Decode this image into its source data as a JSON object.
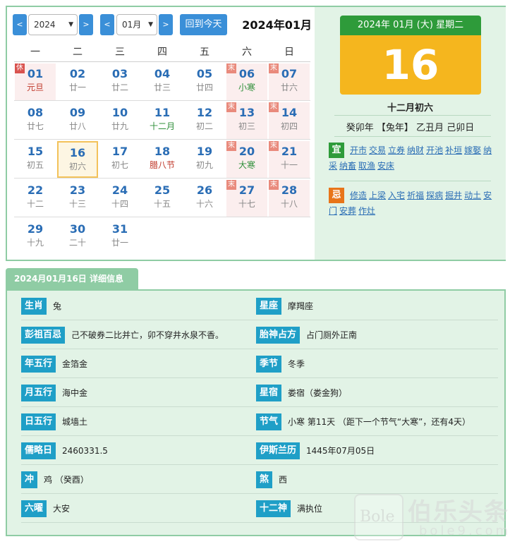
{
  "toolbar": {
    "prev_label": "<",
    "next_label": ">",
    "year_value": "2024",
    "month_value": "01月",
    "today_label": "回到今天",
    "current_title": "2024年01月"
  },
  "weekdays": [
    "一",
    "二",
    "三",
    "四",
    "五",
    "六",
    "日"
  ],
  "weeks": [
    [
      {
        "day": "01",
        "lunar": "元旦",
        "tag": "休",
        "lunar_style": "red"
      },
      {
        "day": "02",
        "lunar": "廿一"
      },
      {
        "day": "03",
        "lunar": "廿二"
      },
      {
        "day": "04",
        "lunar": "廿三"
      },
      {
        "day": "05",
        "lunar": "廿四"
      },
      {
        "day": "06",
        "lunar": "小寒",
        "tag": "末",
        "lunar_style": "green"
      },
      {
        "day": "07",
        "lunar": "廿六",
        "tag": "末"
      }
    ],
    [
      {
        "day": "08",
        "lunar": "廿七"
      },
      {
        "day": "09",
        "lunar": "廿八"
      },
      {
        "day": "10",
        "lunar": "廿九"
      },
      {
        "day": "11",
        "lunar": "十二月",
        "lunar_style": "green"
      },
      {
        "day": "12",
        "lunar": "初二"
      },
      {
        "day": "13",
        "lunar": "初三",
        "tag": "末"
      },
      {
        "day": "14",
        "lunar": "初四",
        "tag": "末"
      }
    ],
    [
      {
        "day": "15",
        "lunar": "初五"
      },
      {
        "day": "16",
        "lunar": "初六",
        "today": true
      },
      {
        "day": "17",
        "lunar": "初七"
      },
      {
        "day": "18",
        "lunar": "腊八节",
        "lunar_style": "red"
      },
      {
        "day": "19",
        "lunar": "初九"
      },
      {
        "day": "20",
        "lunar": "大寒",
        "tag": "末",
        "lunar_style": "green"
      },
      {
        "day": "21",
        "lunar": "十一",
        "tag": "末"
      }
    ],
    [
      {
        "day": "22",
        "lunar": "十二"
      },
      {
        "day": "23",
        "lunar": "十三"
      },
      {
        "day": "24",
        "lunar": "十四"
      },
      {
        "day": "25",
        "lunar": "十五"
      },
      {
        "day": "26",
        "lunar": "十六"
      },
      {
        "day": "27",
        "lunar": "十七",
        "tag": "末"
      },
      {
        "day": "28",
        "lunar": "十八",
        "tag": "末"
      }
    ],
    [
      {
        "day": "29",
        "lunar": "十九"
      },
      {
        "day": "30",
        "lunar": "二十"
      },
      {
        "day": "31",
        "lunar": "廿一"
      },
      null,
      null,
      null,
      null
    ]
  ],
  "day_card": {
    "header": "2024年 01月 (大) 星期二",
    "big_day": "16",
    "lunar_date": "十二月初六",
    "ganzhi": "癸卯年 【兔年】 乙丑月 己卯日"
  },
  "yi": {
    "icon": "宜",
    "items": [
      "开市",
      "交易",
      "立券",
      "纳财",
      "开池",
      "补垣",
      "嫁娶",
      "纳采",
      "纳畜",
      "取渔",
      "安床"
    ]
  },
  "ji": {
    "icon": "忌",
    "items": [
      "修造",
      "上梁",
      "入宅",
      "祈福",
      "探病",
      "掘井",
      "动土",
      "安门",
      "安葬",
      "作灶"
    ]
  },
  "detail_title": "2024月01月16日 详细信息",
  "details": [
    {
      "l_label": "生肖",
      "l_value": "兔",
      "r_label": "星座",
      "r_value": "摩羯座"
    },
    {
      "l_label": "彭祖百忌",
      "l_value": "己不破券二比并亡，卯不穿井水泉不香。",
      "r_label": "胎神占方",
      "r_value": "占门厕外正南"
    },
    {
      "l_label": "年五行",
      "l_value": "金箔金",
      "r_label": "季节",
      "r_value": "冬季"
    },
    {
      "l_label": "月五行",
      "l_value": "海中金",
      "r_label": "星宿",
      "r_value": "娄宿（娄金狗）"
    },
    {
      "l_label": "日五行",
      "l_value": "城墙土",
      "r_label": "节气",
      "r_value": "小寒 第11天 （距下一个节气“大寒”，还有4天）"
    },
    {
      "l_label": "儒略日",
      "l_value": "2460331.5",
      "r_label": "伊斯兰历",
      "r_value": "1445年07月05日"
    },
    {
      "l_label": "冲",
      "l_value": "鸡 （癸酉）",
      "r_label": "煞",
      "r_value": "西"
    },
    {
      "l_label": "六曜",
      "l_value": "大安",
      "r_label": "十二神",
      "r_value": "满执位"
    }
  ],
  "watermark": {
    "logo_text": "Bole",
    "cn_text": "伯乐头条",
    "en_text": "bole9.com"
  },
  "colors": {
    "accent_blue": "#3a8fd8",
    "panel_green": "#8fcca4",
    "card_green": "#2e9b3a",
    "card_yellow": "#f5b61e",
    "label_blue": "#1f9fc7",
    "ji_orange": "#e8751a"
  }
}
